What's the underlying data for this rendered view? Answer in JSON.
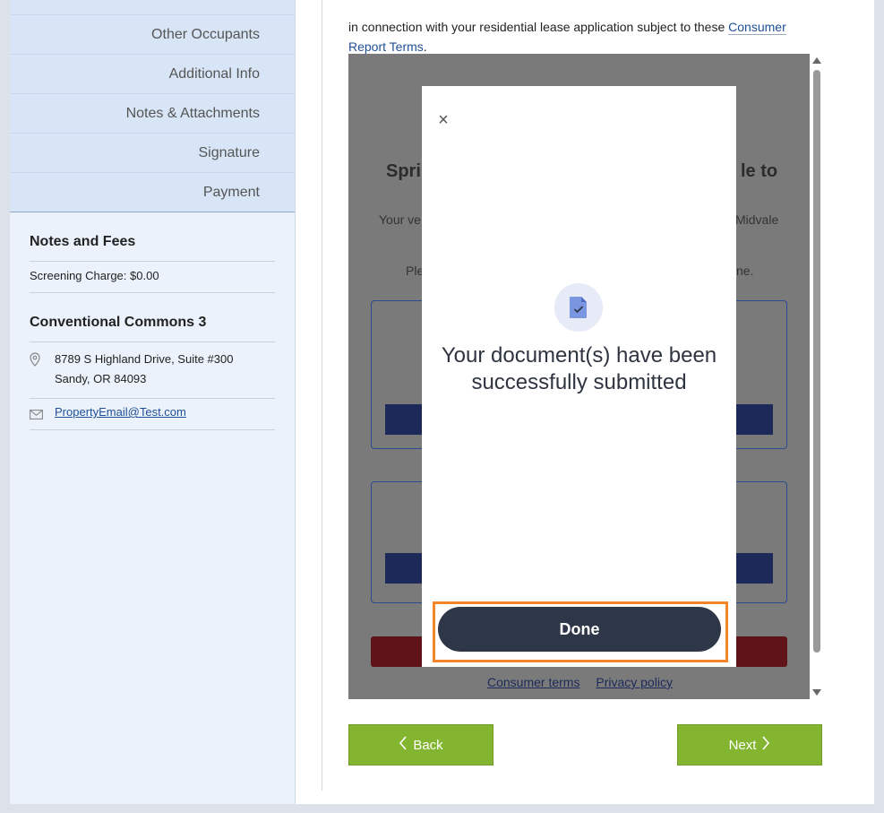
{
  "sidebar": {
    "nav": [
      "",
      "Other Occupants",
      "Additional Info",
      "Notes & Attachments",
      "Signature",
      "Payment"
    ],
    "notes_title": "Notes and Fees",
    "screening": "Screening Charge: $0.00",
    "property_title": "Conventional Commons 3",
    "address_line1": "8789 S Highland Drive, Suite #300",
    "address_line2": "Sandy, OR 84093",
    "email": "PropertyEmail@Test.com"
  },
  "intro": {
    "line1": "in connection with your residential lease application subject to these",
    "link": "Consumer Report Terms"
  },
  "background": {
    "title_left": "Spri",
    "title_right": "le to",
    "text1_left": "Your ve",
    "text1_right": "Midvale",
    "text2_left": "Ple",
    "text2_right": "ne.",
    "link1": "Consumer terms",
    "link2": "Privacy policy"
  },
  "modal": {
    "close": "×",
    "message": "Your document(s) have been successfully submitted",
    "done_label": "Done"
  },
  "footer": {
    "back_label": "Back",
    "next_label": "Next"
  },
  "colors": {
    "accent_green": "#84b531",
    "done_button": "#2e3747",
    "highlight": "#f2862b"
  }
}
